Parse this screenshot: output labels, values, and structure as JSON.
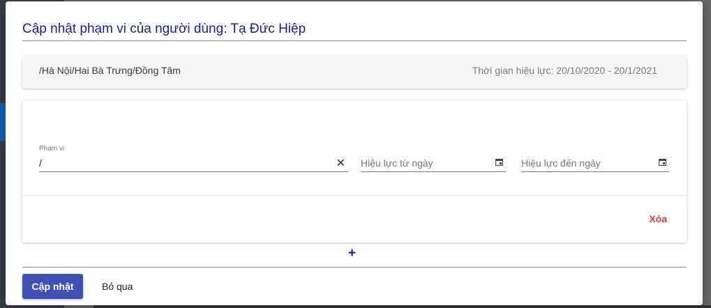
{
  "dialog": {
    "title": "Cập nhật phạm vi của người dùng: Tạ Đức Hiệp"
  },
  "scope_summary": {
    "path": "/Hà Nội/Hai Bà Trưng/Đồng Tâm",
    "validity": "Thời gian hiệu lực: 20/10/2020 - 20/1/2021"
  },
  "form": {
    "scope_label": "Phạm vi",
    "scope_value": "/",
    "clear_icon": "close-icon",
    "from_date_placeholder": "Hiệu lực từ ngày",
    "to_date_placeholder": "Hiệu lực đến ngày",
    "calendar_icon": "calendar-icon",
    "delete_label": "Xóa"
  },
  "add_label": "+",
  "actions": {
    "update_label": "Cập nhật",
    "skip_label": "Bỏ qua"
  },
  "colors": {
    "title": "#1a1aa6",
    "primary_button": "#3f51b5",
    "delete": "#e53935"
  }
}
